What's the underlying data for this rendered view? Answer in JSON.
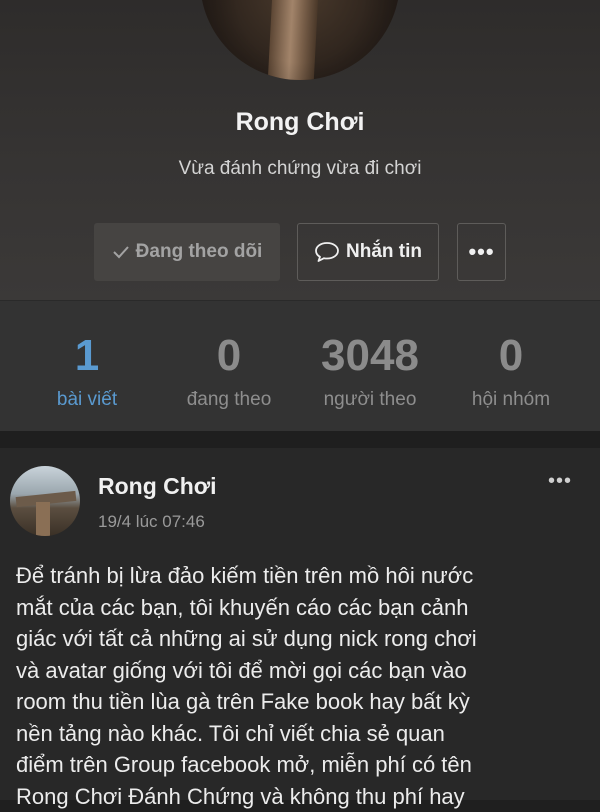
{
  "profile": {
    "name": "Rong Chơi",
    "bio": "Vừa đánh chứng vừa đi chơi"
  },
  "actions": {
    "following_label": "Đang theo dõi",
    "message_label": "Nhắn tin",
    "more_label": "•••"
  },
  "stats": [
    {
      "value": "1",
      "label": "bài viết",
      "active": true
    },
    {
      "value": "0",
      "label": "đang theo",
      "active": false
    },
    {
      "value": "3048",
      "label": "người theo",
      "active": false
    },
    {
      "value": "0",
      "label": "hội nhóm",
      "active": false
    }
  ],
  "post": {
    "author": "Rong Chơi",
    "time": "19/4 lúc 07:46",
    "more_label": "•••",
    "body": "Để tránh bị lừa đảo kiếm tiền trên mồ hôi nước\nmắt của các bạn, tôi khuyến cáo các bạn cảnh\ngiác với tất cả những ai sử dụng nick rong chơi\nvà avatar giống với tôi để mời gọi các bạn vào\nroom thu tiền lùa gà trên Fake book hay bất kỳ\nnền tảng nào khác. Tôi chỉ viết chia sẻ quan\nđiểm trên  Group facebook mở, miễn phí có tên\nRong Chơi Đánh Chứng và không thu phí hay"
  },
  "colors": {
    "accent": "#5a9ad0",
    "background": "#1f1f1f",
    "header_background": "#363433",
    "stats_background": "#333333",
    "post_background": "#282828"
  }
}
